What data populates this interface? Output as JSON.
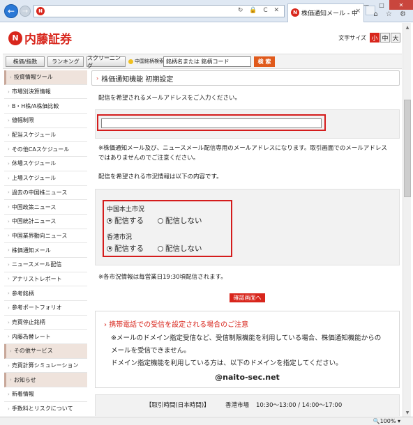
{
  "browser": {
    "tab_title": "株価通知メール - 中国...",
    "tab_close": "×",
    "address_icons": "↻ 🔒 C ✕",
    "window_icons": "⌂ ☆ ⚙",
    "win_min": "—",
    "win_max": "□",
    "win_close": "✕",
    "back": "←",
    "forward": "→",
    "favicon": "N",
    "zoom": "🔍100%  ▾"
  },
  "header": {
    "logo_mark": "N",
    "logo_text": "内藤証券",
    "font_size_label": "文字サイズ",
    "font_sizes": [
      "小",
      "中",
      "大"
    ]
  },
  "searchbar": {
    "buttons": [
      "株価/指数",
      "ランキング",
      "スクリーニング"
    ],
    "search_label": "中国銘柄検索",
    "search_placeholder": "銘柄名または 銘柄コード",
    "search_button": "検 索"
  },
  "sidebar": {
    "items": [
      {
        "label": "投資情報ツール",
        "head": true
      },
      {
        "label": "市場別決算情報"
      },
      {
        "label": "B・H株/A株価比較"
      },
      {
        "label": "値幅制限"
      },
      {
        "label": "配当スケジュール"
      },
      {
        "label": "その他CAスケジュール"
      },
      {
        "label": "休場スケジュール"
      },
      {
        "label": "上場スケジュール"
      },
      {
        "label": "過去の中国株ニュース"
      },
      {
        "label": "中国政策ニュース"
      },
      {
        "label": "中国統計ニュース"
      },
      {
        "label": "中国業界動向ニュース"
      },
      {
        "label": "株価通知メール"
      },
      {
        "label": "ニュースメール配信"
      },
      {
        "label": "アナリストレポート"
      },
      {
        "label": "参考銘柄"
      },
      {
        "label": "参考ポートフォリオ"
      },
      {
        "label": "売買停止銘柄"
      },
      {
        "label": "内藤為替レート"
      },
      {
        "label": "その他サービス",
        "head": true
      },
      {
        "label": "売買計算シミュレーション"
      },
      {
        "label": "お知らせ",
        "head": true
      },
      {
        "label": "新着情報"
      },
      {
        "label": "手数料とリスクについて"
      }
    ]
  },
  "main": {
    "title": "株価通知機能 初期設定",
    "email_prompt": "配信を希望されるメールアドレスをご入力ください。",
    "email_value": "",
    "note1": "※株価通知メール及び、ニュースメール配信専用のメールアドレスになります。取引画面でのメールアドレスではありませんのでご注意ください。",
    "market_prompt": "配信を希望される市況情報は以下の内容です。",
    "markets": [
      {
        "title": "中国本土市況",
        "opt_on": "配信する",
        "opt_off": "配信しない"
      },
      {
        "title": "香港市況",
        "opt_on": "配信する",
        "opt_off": "配信しない"
      }
    ],
    "note2": "※各市況情報は毎営業日19:30頃配信されます。",
    "confirm_button": "確認画面へ"
  },
  "notice": {
    "head": "携帯電話での受信を設定される場合のご注意",
    "lines": [
      "※メールのドメイン指定受信など、受信制限機能を利用している場合、株価通知機能からの",
      "メールを受信できません。",
      "ドメイン指定機能を利用している方は、以下のドメインを指定してください。"
    ],
    "domain": "@naito-sec.net"
  },
  "hours": {
    "label": "【取引時間(日本時間)】",
    "market": "香港市場",
    "times": "10:30～13:00 / 14:00～17:00"
  }
}
